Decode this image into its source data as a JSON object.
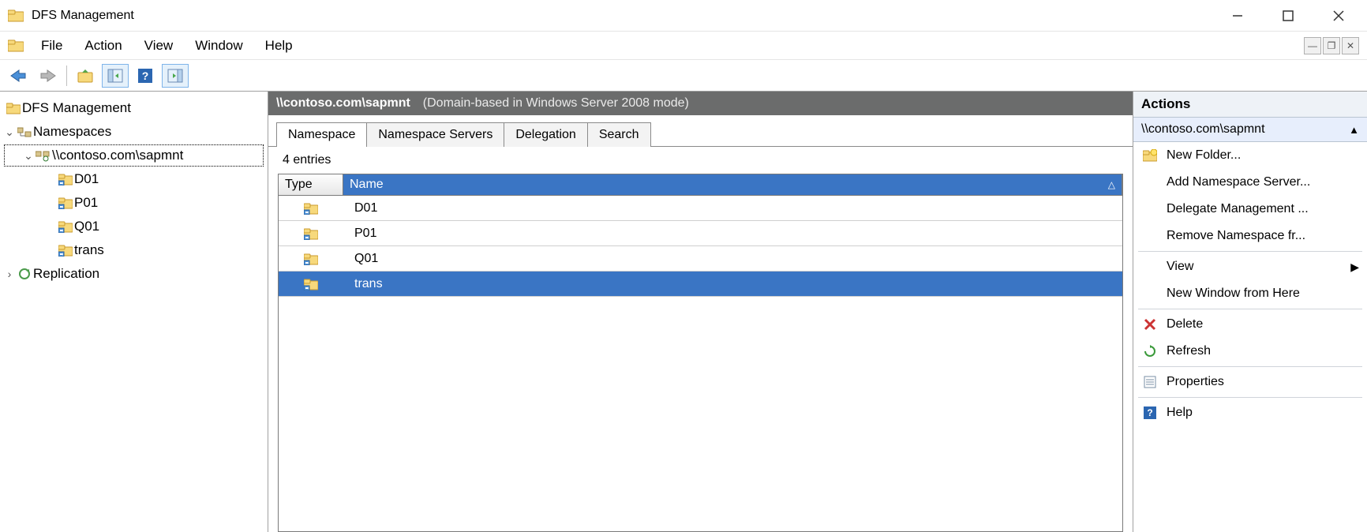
{
  "window": {
    "title": "DFS Management"
  },
  "menu": {
    "items": [
      "File",
      "Action",
      "View",
      "Window",
      "Help"
    ]
  },
  "tree": {
    "root": "DFS Management",
    "namespaces_label": "Namespaces",
    "namespace_path": "\\\\contoso.com\\sapmnt",
    "folders": [
      "D01",
      "P01",
      "Q01",
      "trans"
    ],
    "replication_label": "Replication"
  },
  "content": {
    "path": "\\\\contoso.com\\sapmnt",
    "mode": "(Domain-based in Windows Server 2008 mode)",
    "tabs": [
      "Namespace",
      "Namespace Servers",
      "Delegation",
      "Search"
    ],
    "active_tab": 0,
    "entries_label": "4 entries",
    "columns": {
      "type": "Type",
      "name": "Name"
    },
    "rows": [
      {
        "name": "D01",
        "selected": false
      },
      {
        "name": "P01",
        "selected": false
      },
      {
        "name": "Q01",
        "selected": false
      },
      {
        "name": "trans",
        "selected": true
      }
    ]
  },
  "actions": {
    "header": "Actions",
    "context": "\\\\contoso.com\\sapmnt",
    "items": [
      {
        "label": "New Folder...",
        "icon": "new-folder"
      },
      {
        "label": "Add Namespace Server...",
        "icon": ""
      },
      {
        "label": "Delegate Management ...",
        "icon": ""
      },
      {
        "label": "Remove Namespace fr...",
        "icon": ""
      },
      {
        "sep": true
      },
      {
        "label": "View",
        "icon": "",
        "submenu": true
      },
      {
        "label": "New Window from Here",
        "icon": ""
      },
      {
        "sep": true
      },
      {
        "label": "Delete",
        "icon": "delete"
      },
      {
        "label": "Refresh",
        "icon": "refresh"
      },
      {
        "sep": true
      },
      {
        "label": "Properties",
        "icon": "properties"
      },
      {
        "sep": true
      },
      {
        "label": "Help",
        "icon": "help"
      }
    ]
  }
}
